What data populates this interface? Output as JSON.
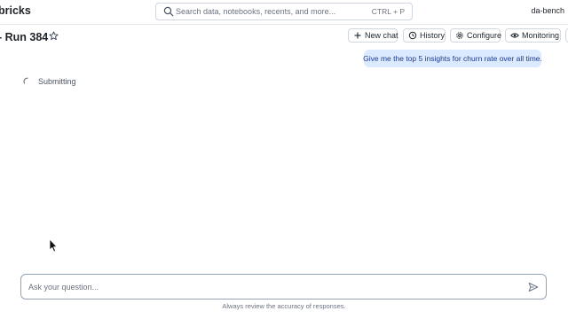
{
  "topbar": {
    "brand": "bricks",
    "search_placeholder": "Search data, notebooks, recents, and more...",
    "search_shortcut": "CTRL + P",
    "user": "da-bench"
  },
  "page": {
    "title": "- Run 384"
  },
  "toolbar": {
    "new_chat": "New chat",
    "history": "History",
    "configure": "Configure",
    "monitoring": "Monitoring"
  },
  "chat": {
    "user_message": "Give me the top 5 insights for churn rate over all time.",
    "status": "Submitting"
  },
  "composer": {
    "placeholder": "Ask your question...",
    "disclaimer": "Always review the accuracy of responses."
  },
  "icons": {
    "search": "search-icon",
    "star": "star-icon",
    "new_chat": "plus-icon",
    "history": "history-icon",
    "configure": "gear-icon",
    "monitoring": "eye-icon",
    "send": "send-icon",
    "spinner": "spinner-icon"
  }
}
